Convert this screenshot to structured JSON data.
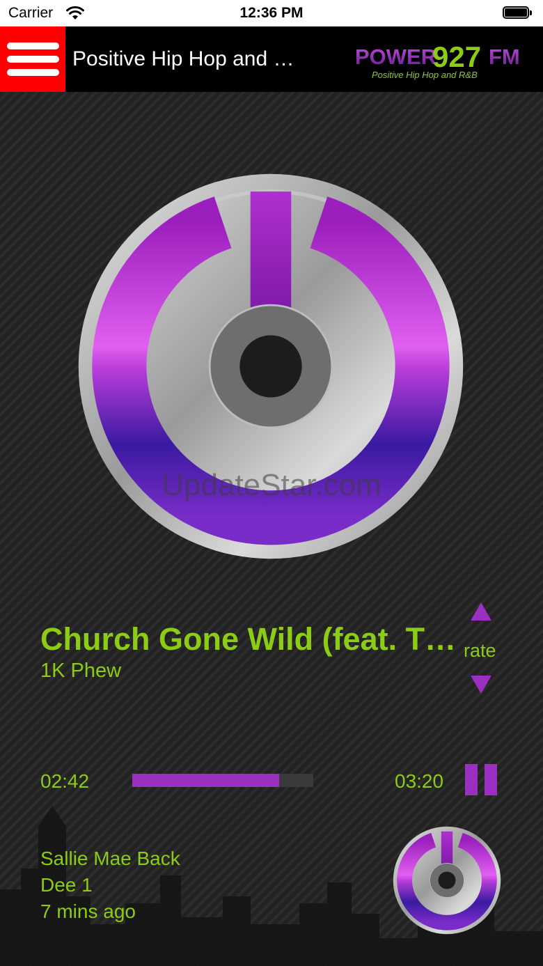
{
  "status_bar": {
    "carrier": "Carrier",
    "time": "12:36 PM"
  },
  "navbar": {
    "title": "Positive Hip Hop and …",
    "logo": {
      "brand": "POWER",
      "frequency": "927",
      "band": "FM",
      "tagline": "Positive Hip Hop and R&B"
    }
  },
  "watermark": "UpdateStar.com",
  "now_playing": {
    "title": "Church Gone Wild (feat. T…",
    "artist": "1K Phew",
    "rate_label": "rate",
    "elapsed": "02:42",
    "duration": "03:20",
    "progress_fraction": 0.81
  },
  "recent": {
    "title": "Sallie Mae Back",
    "artist": "Dee 1",
    "time_ago": "7 mins ago"
  },
  "colors": {
    "accent_green": "#8ccc14",
    "accent_purple": "#9b2fc0",
    "menu_red": "#ff0000"
  },
  "icons": [
    "wifi-icon",
    "battery-icon",
    "hamburger-menu-icon",
    "triangle-up-icon",
    "triangle-down-icon",
    "pause-icon",
    "power-disc-icon"
  ]
}
